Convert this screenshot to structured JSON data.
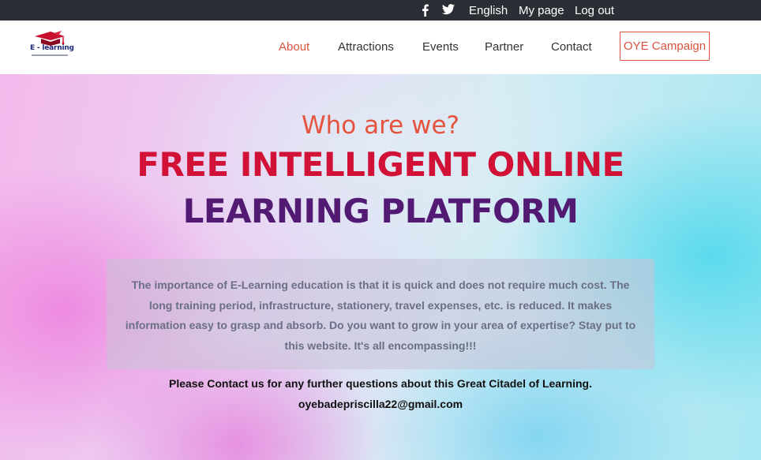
{
  "topbar": {
    "social": [
      {
        "icon": "facebook-icon"
      },
      {
        "icon": "twitter-icon"
      }
    ],
    "language": "English",
    "my_page": "My page",
    "logout": "Log out"
  },
  "logo": {
    "text": "E - learning"
  },
  "nav": {
    "items": [
      {
        "label": "About",
        "active": true
      },
      {
        "label": "Attractions"
      },
      {
        "label": "Events"
      },
      {
        "label": "Partner"
      },
      {
        "label": "Contact"
      }
    ],
    "cta": "OYE Campaign"
  },
  "hero": {
    "eyebrow": "Who are we?",
    "title_line1": "FREE INTELLIGENT ONLINE",
    "title_line2": "LEARNING PLATFORM",
    "about": "The importance of E-Learning education is that it is quick and does not require much cost. The long training period, infrastructure, stationery, travel expenses, etc. is reduced. It makes information easy to grasp and absorb. Do you want to grow in your area of expertise? Stay put to this website. It's all encompassing!!!",
    "contact_prompt": "Please Contact us for any further questions about this Great Citadel of Learning.",
    "email": "oyebadepriscilla22@gmail.com"
  },
  "colors": {
    "topbar_bg": "#2b2e34",
    "accent": "#d9533f",
    "title_red": "#d11236",
    "title_purple": "#531a73"
  }
}
